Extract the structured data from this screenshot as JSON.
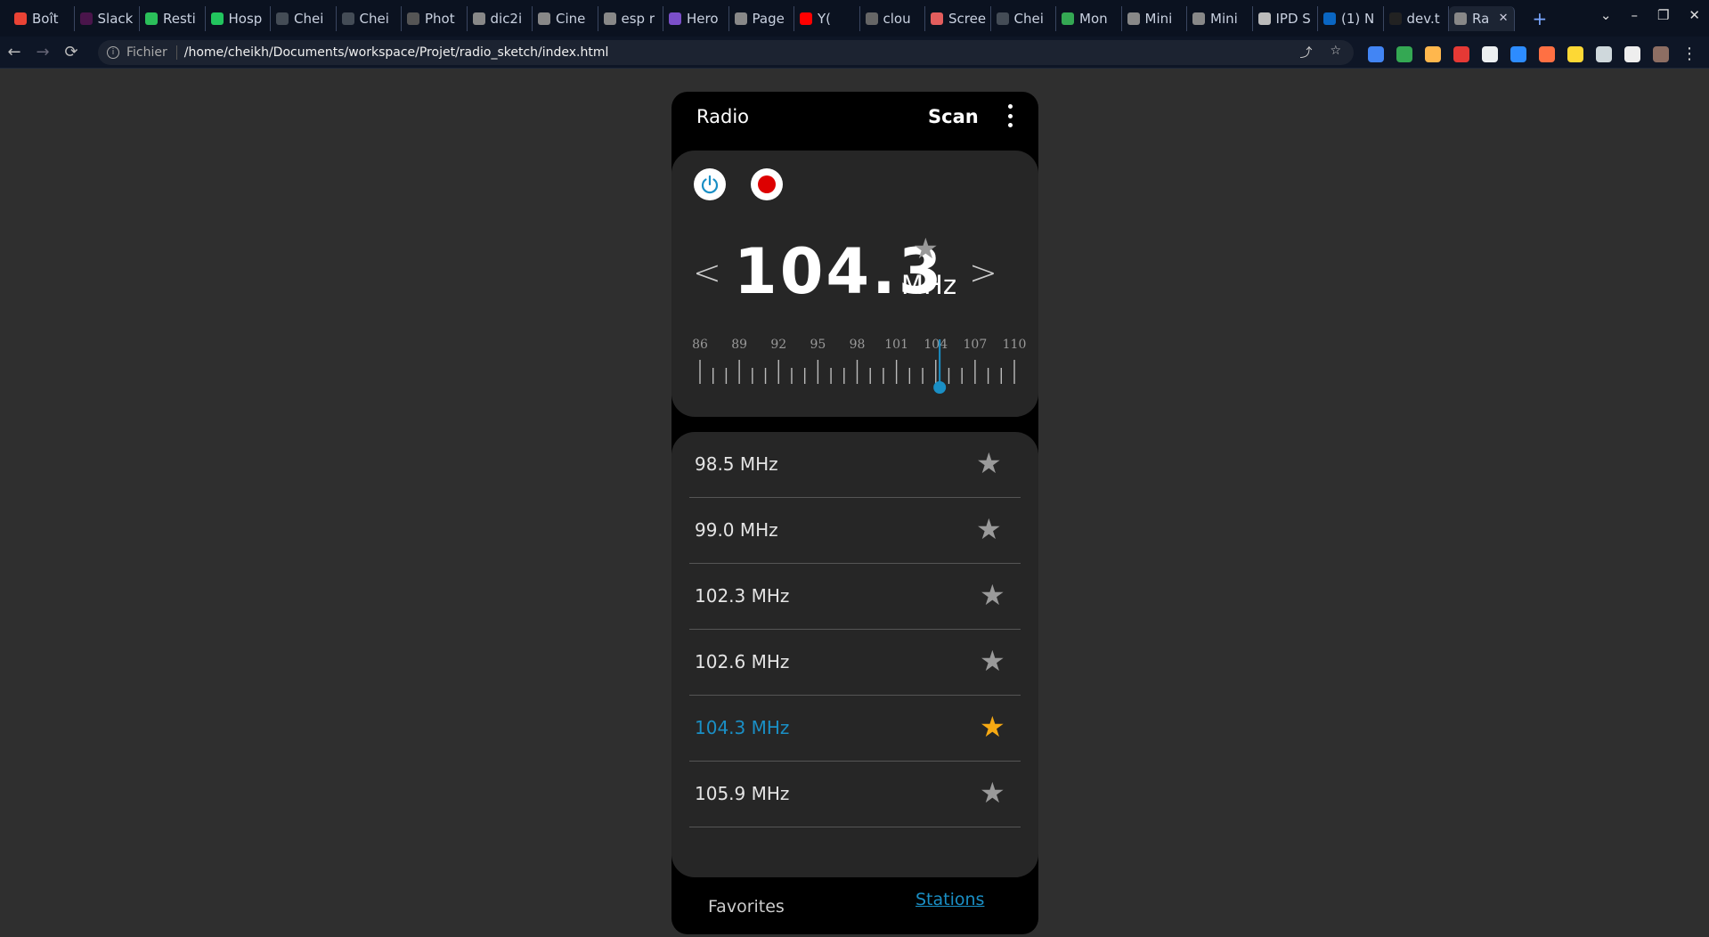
{
  "browser": {
    "tabs": [
      {
        "label": "Boît",
        "color": "#ea4335"
      },
      {
        "label": "Slack",
        "color": "#4a154b"
      },
      {
        "label": "Resti",
        "color": "#2bbf5a"
      },
      {
        "label": "Hosp",
        "color": "#22c55e"
      },
      {
        "label": "Chei",
        "color": "#444c56"
      },
      {
        "label": "Chei",
        "color": "#444c56"
      },
      {
        "label": "Phot",
        "color": "#555"
      },
      {
        "label": "dic2i",
        "color": "#888"
      },
      {
        "label": "Cine",
        "color": "#888"
      },
      {
        "label": "esp r",
        "color": "#888"
      },
      {
        "label": "Hero",
        "color": "#7b4fc9"
      },
      {
        "label": "Page",
        "color": "#888"
      },
      {
        "label": "Y(",
        "color": "#ff0000"
      },
      {
        "label": "clou",
        "color": "#666"
      },
      {
        "label": "Scree",
        "color": "#e35d5d"
      },
      {
        "label": "Chei",
        "color": "#444c56"
      },
      {
        "label": "Mon",
        "color": "#34a853"
      },
      {
        "label": "Mini",
        "color": "#888"
      },
      {
        "label": "Mini",
        "color": "#888"
      },
      {
        "label": "IPD S",
        "color": "#bbb"
      },
      {
        "label": "(1) N",
        "color": "#0a66c2"
      },
      {
        "label": "dev.t",
        "color": "#222"
      },
      {
        "label": "Ra",
        "color": "#888",
        "active": true
      }
    ],
    "new_tab": "+",
    "window_controls": [
      "⌄",
      "–",
      "❐",
      "✕"
    ],
    "nav": {
      "back": "←",
      "forward": "→",
      "reload": "⟳"
    },
    "address": {
      "scheme_label": "Fichier",
      "url": "/home/cheikh/Documents/workspace/Projet/radio_sketch/index.html",
      "share_icon": "⤴",
      "bookmark_icon": "☆"
    },
    "extensions": [
      "#4285f4",
      "#34a853",
      "#ffb74d",
      "#e53935",
      "#eceff1",
      "#2d8cff",
      "#ff7043",
      "#fdd835",
      "#cfd8dc",
      "#eeeeee",
      "#8d6e63"
    ],
    "menu_icon": "⋮"
  },
  "radio": {
    "title": "Radio",
    "scan_label": "Scan",
    "frequency": "104.3",
    "unit": "MHz",
    "prev": "<",
    "next": ">",
    "star": "★",
    "scale": {
      "min": 86,
      "max": 110,
      "labels": [
        "86",
        "89",
        "92",
        "95",
        "98",
        "101",
        "104",
        "107",
        "110"
      ],
      "current": 104.3
    },
    "stations": [
      {
        "label": "98.5 MHz",
        "selected": false
      },
      {
        "label": "99.0 MHz",
        "selected": false
      },
      {
        "label": "102.3 MHz",
        "selected": false
      },
      {
        "label": "102.6 MHz",
        "selected": false
      },
      {
        "label": "104.3 MHz",
        "selected": true
      },
      {
        "label": "105.9 MHz",
        "selected": false
      }
    ],
    "nav": {
      "favorites": "Favorites",
      "stations": "Stations"
    },
    "colors": {
      "accent": "#1a8fc5",
      "favorite": "#f6a913",
      "record": "#dd0000"
    }
  }
}
